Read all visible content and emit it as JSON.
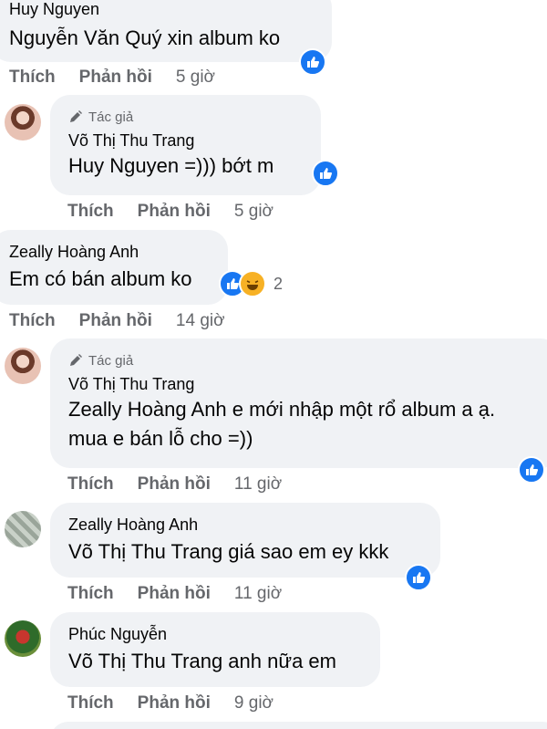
{
  "comments": [
    {
      "author": "Huy Nguyen",
      "mention": "Nguyễn Văn Quý",
      "text": " xin album ko",
      "actions": {
        "like": "Thích",
        "reply": "Phản hồi",
        "time": "5 giờ"
      }
    },
    {
      "badge": "Tác giả",
      "author": "Võ Thị Thu Trang",
      "mention": "Huy Nguyen",
      "text": " =))) bớt m",
      "actions": {
        "like": "Thích",
        "reply": "Phản hồi",
        "time": "5 giờ"
      }
    },
    {
      "author": "Zeally Hoàng Anh",
      "text": "Em có bán album ko",
      "reaction_count": "2",
      "actions": {
        "like": "Thích",
        "reply": "Phản hồi",
        "time": "14 giờ"
      }
    },
    {
      "badge": "Tác giả",
      "author": "Võ Thị Thu Trang",
      "mention": "Zeally Hoàng Anh",
      "text_line1": " e mới nhập một rổ album a ạ.",
      "text_line2": "mua e bán lỗ cho =))",
      "actions": {
        "like": "Thích",
        "reply": "Phản hồi",
        "time": "11 giờ"
      }
    },
    {
      "author": "Zeally Hoàng Anh",
      "mention": "Võ Thị Thu Trang",
      "text": " giá sao em ey kkk",
      "actions": {
        "like": "Thích",
        "reply": "Phản hồi",
        "time": "11 giờ"
      }
    },
    {
      "author": "Phúc Nguyễn",
      "mention": "Võ Thị Thu Trang",
      "text": " anh nữa em",
      "actions": {
        "like": "Thích",
        "reply": "Phản hồi",
        "time": "9 giờ"
      }
    }
  ],
  "colors": {
    "bubble": "#f0f2f5",
    "like": "#1877f2",
    "meta": "#65676b"
  }
}
